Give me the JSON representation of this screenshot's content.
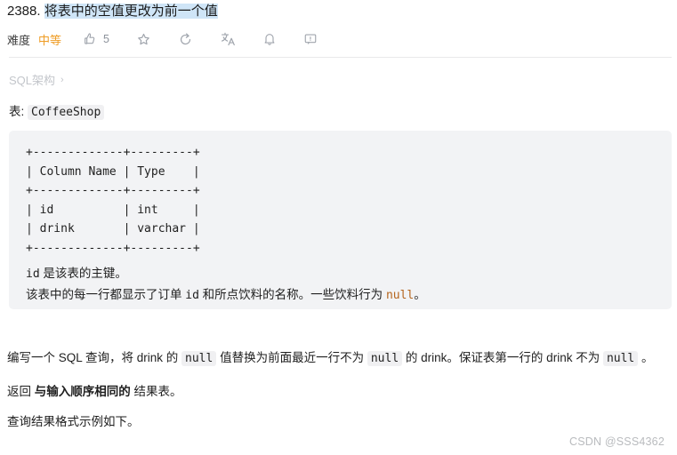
{
  "title": {
    "number": "2388. ",
    "selected_text": "将表中的空值更改为前一个值"
  },
  "meta": {
    "difficulty_label": "难度",
    "difficulty_value": "中等",
    "difficulty_color": "#ef9c24",
    "like_count": "5",
    "icons": [
      "thumbs-up-icon",
      "star-icon",
      "share-refresh-icon",
      "translate-icon",
      "bell-icon",
      "comment-icon"
    ]
  },
  "schema": {
    "toggle_label": "SQL架构",
    "chevron": "›"
  },
  "table_intro": {
    "prefix": "表: ",
    "table_name": "CoffeeShop"
  },
  "code_block": {
    "ascii_table": "+-------------+---------+\n| Column Name | Type    |\n+-------------+---------+\n| id          | int     |\n| drink       | varchar |\n+-------------+---------+",
    "note_line1_code": "id",
    "note_line1_text": " 是该表的主键。",
    "note_line2_a": "该表中的每一行都显示了订单 ",
    "note_line2_code1": "id",
    "note_line2_b": " 和所点饮料的名称。一些饮料行为 ",
    "note_line2_code2": "null",
    "note_line2_c": "。"
  },
  "paragraphs": {
    "p1_a": "编写一个 SQL 查询，将 drink 的 ",
    "p1_code1": "null",
    "p1_b": " 值替换为前面最近一行不为 ",
    "p1_code2": "null",
    "p1_c": " 的 drink。保证表第一行的 drink 不为 ",
    "p1_code3": "null",
    "p1_d": " 。",
    "p2_a": "返回 ",
    "p2_bold": "与输入顺序相同的",
    "p2_b": " 结果表。",
    "p3": "查询结果格式示例如下。"
  },
  "watermark": "CSDN @SSS4362"
}
